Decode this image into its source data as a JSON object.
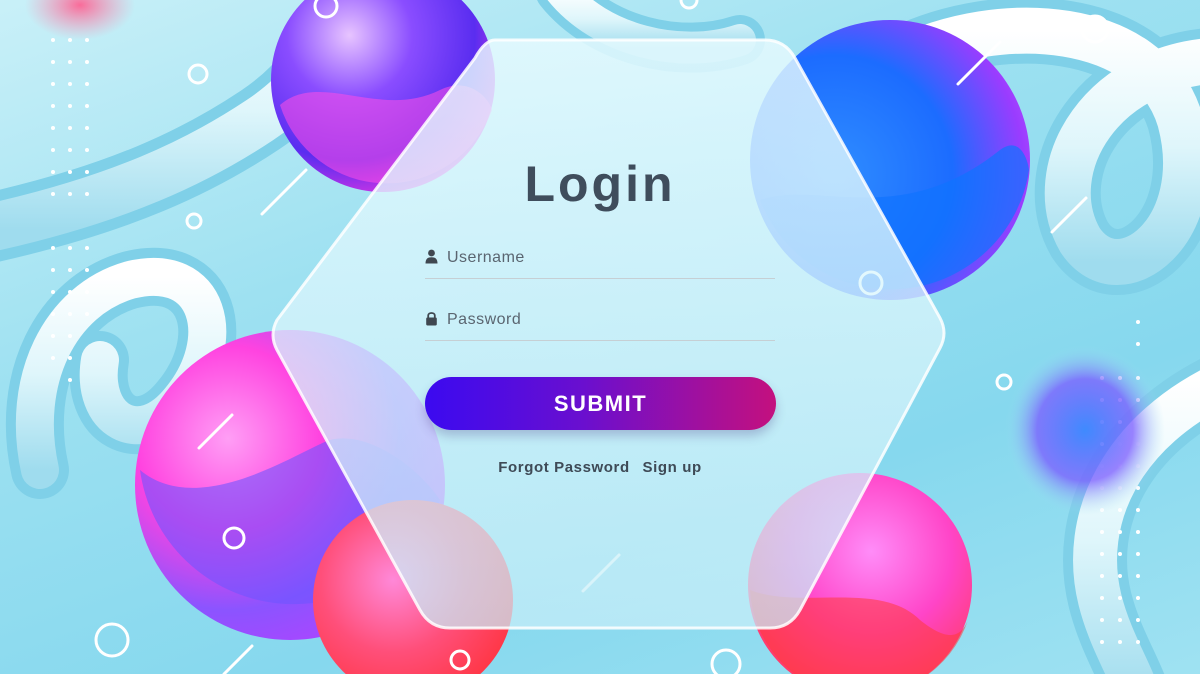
{
  "login": {
    "title": "Login",
    "username_placeholder": "Username",
    "password_placeholder": "Password",
    "submit_label": "SUBMIT",
    "forgot_password_label": "Forgot Password",
    "signup_label": "Sign up"
  },
  "icons": {
    "username": "user-icon",
    "password": "lock-icon"
  },
  "colors": {
    "title": "#3f4d5c",
    "submit_gradient_start": "#3b0af0",
    "submit_gradient_end": "#c4107e",
    "background": "#9ee1f1",
    "tube": "#e6f8fc",
    "sphere_pink": "#ff3fd2",
    "sphere_blue": "#1e8bff",
    "sphere_red": "#ff3c3c"
  }
}
